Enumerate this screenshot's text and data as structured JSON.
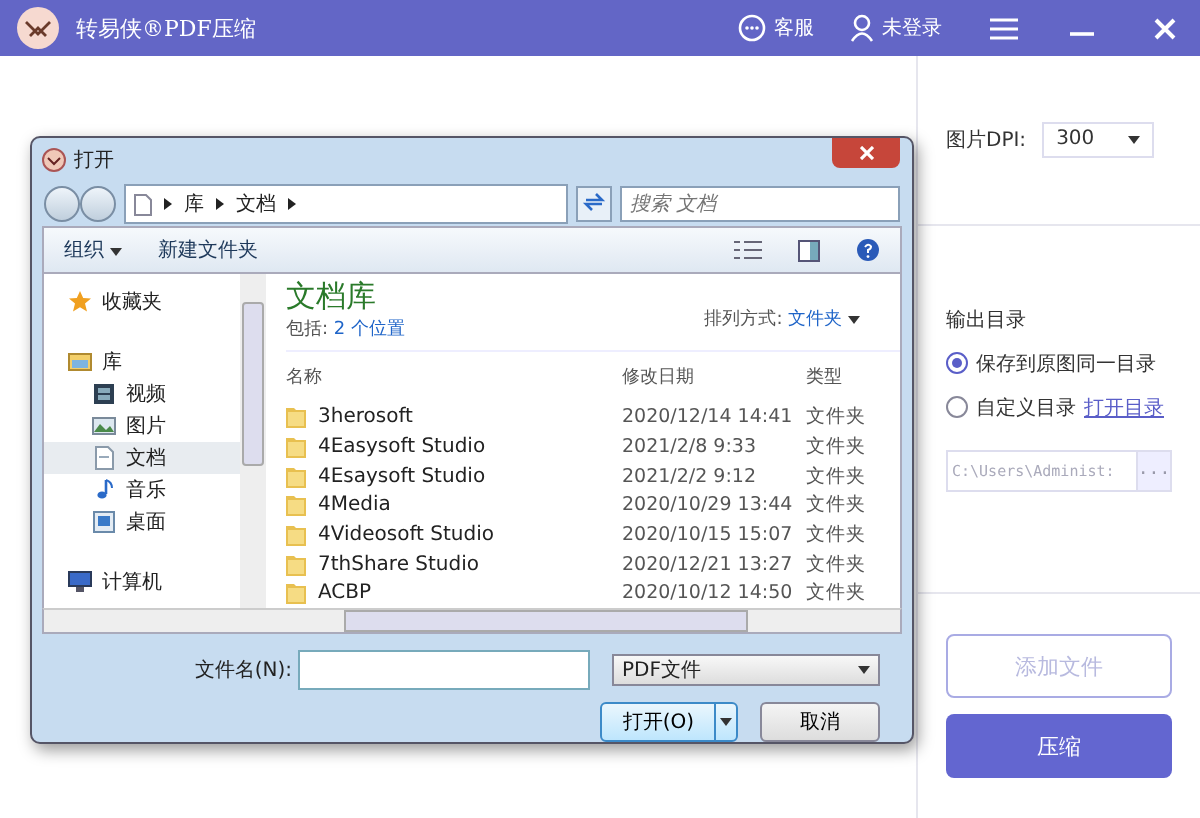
{
  "app": {
    "title": "转易侠®PDF压缩",
    "actions": [
      {
        "kind": "chat",
        "label": "客服"
      },
      {
        "kind": "user",
        "label": "未登录"
      }
    ]
  },
  "settings": {
    "dpi_label": "图片DPI:",
    "dpi_value": "300",
    "output_label": "输出目录",
    "radios": [
      {
        "label": "保存到原图同一目录",
        "selected": true
      },
      {
        "label": "自定义目录",
        "link": "打开目录",
        "selected": false
      }
    ],
    "path_value": "C:\\Users\\Administ:",
    "path_button": "...",
    "add_button": "添加文件",
    "compress_button": "压缩"
  },
  "dialog": {
    "title": "打开",
    "breadcrumb": [
      "库",
      "文档"
    ],
    "search": {
      "placeholder": "搜索 文档"
    },
    "organize": "组织",
    "new_folder": "新建文件夹",
    "nav": [
      {
        "kind": "favorites",
        "label": "收藏夹",
        "selected": false
      },
      {
        "kind": "library",
        "label": "库",
        "selected": false,
        "children": [
          {
            "kind": "video",
            "label": "视频",
            "selected": false
          },
          {
            "kind": "pictures",
            "label": "图片",
            "selected": false
          },
          {
            "kind": "documents",
            "label": "文档",
            "selected": true
          },
          {
            "kind": "music",
            "label": "音乐",
            "selected": false
          },
          {
            "kind": "desktop",
            "label": "桌面",
            "selected": false
          }
        ]
      },
      {
        "kind": "computer",
        "label": "计算机",
        "selected": false
      }
    ],
    "library_title": "文档库",
    "includes_label": "包括:",
    "includes_link": "2 个位置",
    "sort_label": "排列方式:",
    "sort_value": "文件夹",
    "columns": [
      "名称",
      "修改日期",
      "类型"
    ],
    "rows": [
      {
        "name": "3herosoft",
        "date": "2020/12/14 14:41",
        "type": "文件夹"
      },
      {
        "name": "4Easysoft Studio",
        "date": "2021/2/8 9:33",
        "type": "文件夹"
      },
      {
        "name": "4Esaysoft Studio",
        "date": "2021/2/2 9:12",
        "type": "文件夹"
      },
      {
        "name": "4Media",
        "date": "2020/10/29 13:44",
        "type": "文件夹"
      },
      {
        "name": "4Videosoft Studio",
        "date": "2020/10/15 15:07",
        "type": "文件夹"
      },
      {
        "name": "7thShare Studio",
        "date": "2020/12/21 13:27",
        "type": "文件夹"
      },
      {
        "name": "ACBP",
        "date": "2020/10/12 14:50",
        "type": "文件夹"
      }
    ],
    "filename_label": "文件名(N):",
    "file_type": "PDF文件",
    "open_button": "打开(O)",
    "cancel_button": "取消"
  }
}
